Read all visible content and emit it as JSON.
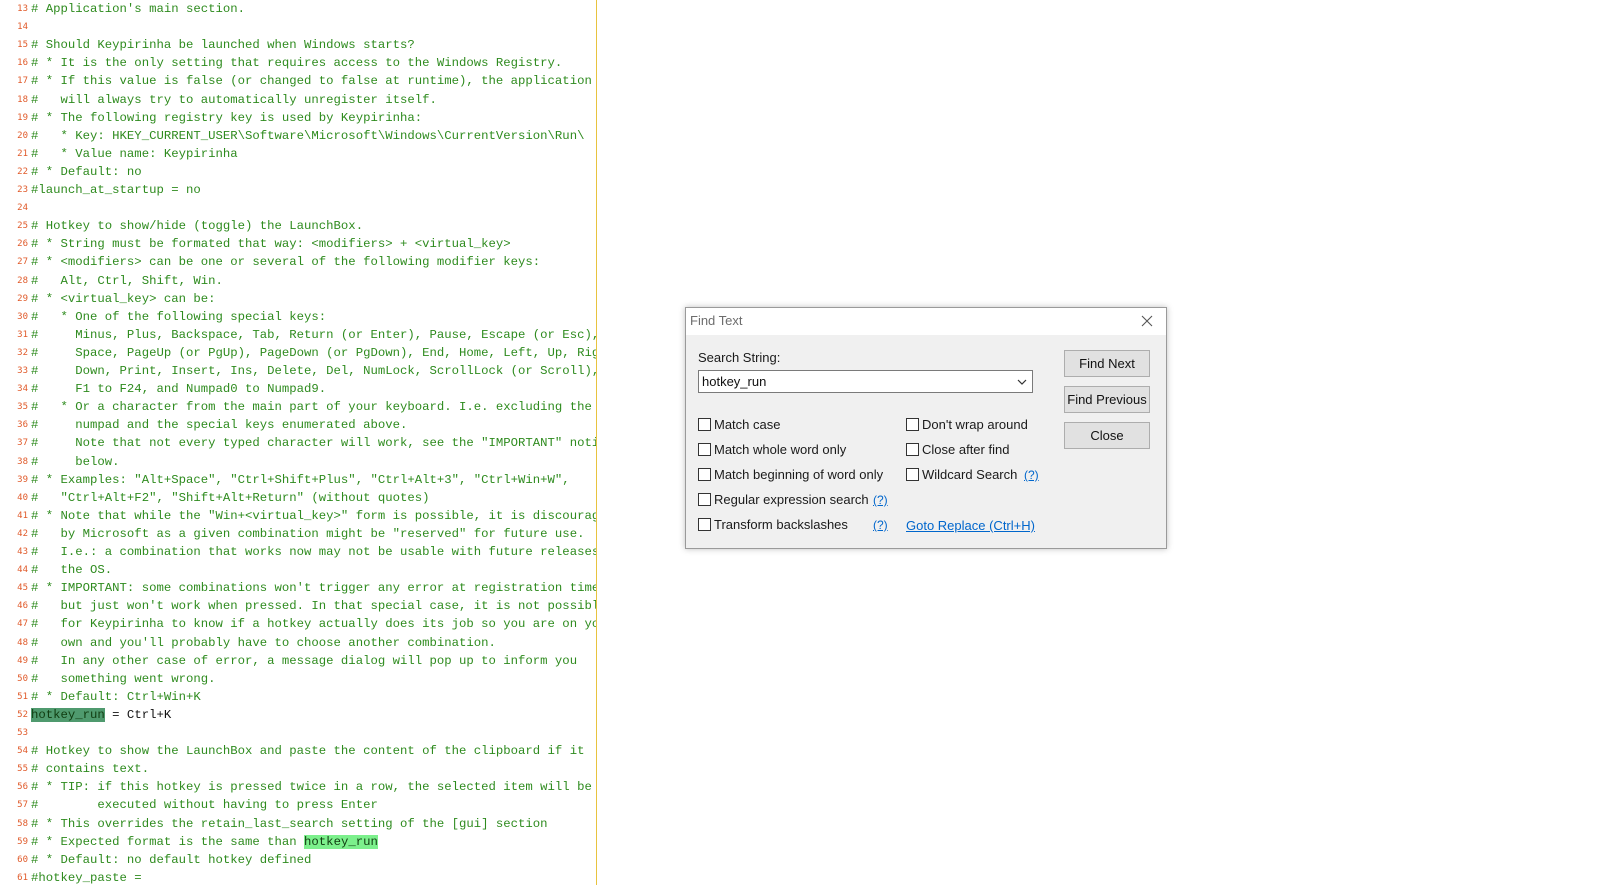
{
  "editor": {
    "lines": [
      {
        "num": "13",
        "text": "# Application's main section."
      },
      {
        "num": "14",
        "text": ""
      },
      {
        "num": "15",
        "text": "# Should Keypirinha be launched when Windows starts?"
      },
      {
        "num": "16",
        "text": "# * It is the only setting that requires access to the Windows Registry."
      },
      {
        "num": "17",
        "text": "# * If this value is false (or changed to false at runtime), the application"
      },
      {
        "num": "18",
        "text": "#   will always try to automatically unregister itself."
      },
      {
        "num": "19",
        "text": "# * The following registry key is used by Keypirinha:"
      },
      {
        "num": "20",
        "text": "#   * Key: HKEY_CURRENT_USER\\Software\\Microsoft\\Windows\\CurrentVersion\\Run\\"
      },
      {
        "num": "21",
        "text": "#   * Value name: Keypirinha"
      },
      {
        "num": "22",
        "text": "# * Default: no"
      },
      {
        "num": "23",
        "text": "#launch_at_startup = no"
      },
      {
        "num": "24",
        "text": ""
      },
      {
        "num": "25",
        "text": "# Hotkey to show/hide (toggle) the LaunchBox."
      },
      {
        "num": "26",
        "text": "# * String must be formated that way: <modifiers> + <virtual_key>"
      },
      {
        "num": "27",
        "text": "# * <modifiers> can be one or several of the following modifier keys:"
      },
      {
        "num": "28",
        "text": "#   Alt, Ctrl, Shift, Win."
      },
      {
        "num": "29",
        "text": "# * <virtual_key> can be:"
      },
      {
        "num": "30",
        "text": "#   * One of the following special keys:"
      },
      {
        "num": "31",
        "text": "#     Minus, Plus, Backspace, Tab, Return (or Enter), Pause, Escape (or Esc),"
      },
      {
        "num": "32",
        "text": "#     Space, PageUp (or PgUp), PageDown (or PgDown), End, Home, Left, Up, Right,"
      },
      {
        "num": "33",
        "text": "#     Down, Print, Insert, Ins, Delete, Del, NumLock, ScrollLock (or Scroll),"
      },
      {
        "num": "34",
        "text": "#     F1 to F24, and Numpad0 to Numpad9."
      },
      {
        "num": "35",
        "text": "#   * Or a character from the main part of your keyboard. I.e. excluding the"
      },
      {
        "num": "36",
        "text": "#     numpad and the special keys enumerated above."
      },
      {
        "num": "37",
        "text": "#     Note that not every typed character will work, see the \"IMPORTANT\" notice"
      },
      {
        "num": "38",
        "text": "#     below."
      },
      {
        "num": "39",
        "text": "# * Examples: \"Alt+Space\", \"Ctrl+Shift+Plus\", \"Ctrl+Alt+3\", \"Ctrl+Win+W\","
      },
      {
        "num": "40",
        "text": "#   \"Ctrl+Alt+F2\", \"Shift+Alt+Return\" (without quotes)"
      },
      {
        "num": "41",
        "text": "# * Note that while the \"Win+<virtual_key>\" form is possible, it is discouraged"
      },
      {
        "num": "42",
        "text": "#   by Microsoft as a given combination might be \"reserved\" for future use."
      },
      {
        "num": "43",
        "text": "#   I.e.: a combination that works now may not be usable with future releases of"
      },
      {
        "num": "44",
        "text": "#   the OS."
      },
      {
        "num": "45",
        "text": "# * IMPORTANT: some combinations won't trigger any error at registration time"
      },
      {
        "num": "46",
        "text": "#   but just won't work when pressed. In that special case, it is not possible"
      },
      {
        "num": "47",
        "text": "#   for Keypirinha to know if a hotkey actually does its job so you are on your"
      },
      {
        "num": "48",
        "text": "#   own and you'll probably have to choose another combination."
      },
      {
        "num": "49",
        "text": "#   In any other case of error, a message dialog will pop up to inform you"
      },
      {
        "num": "50",
        "text": "#   something went wrong."
      },
      {
        "num": "51",
        "text": "# * Default: Ctrl+Win+K"
      },
      {
        "num": "52",
        "text": "",
        "hl": "hotkey_run",
        "rest": " = Ctrl+K",
        "hl_kind": "sel",
        "setting": true
      },
      {
        "num": "53",
        "text": ""
      },
      {
        "num": "54",
        "text": "# Hotkey to show the LaunchBox and paste the content of the clipboard if it"
      },
      {
        "num": "55",
        "text": "# contains text."
      },
      {
        "num": "56",
        "text": "# * TIP: if this hotkey is pressed twice in a row, the selected item will be"
      },
      {
        "num": "57",
        "text": "#        executed without having to press Enter"
      },
      {
        "num": "58",
        "text": "# * This overrides the retain_last_search setting of the [gui] section"
      },
      {
        "num": "59",
        "text": "# * Expected format is the same than ",
        "hl": "hotkey_run",
        "rest": "",
        "hl_kind": "match"
      },
      {
        "num": "60",
        "text": "# * Default: no default hotkey defined"
      },
      {
        "num": "61",
        "text": "#hotkey_paste ="
      }
    ]
  },
  "dialog": {
    "title": "Find Text",
    "search_label": "Search String:",
    "search_value": "hotkey_run",
    "buttons": {
      "find_next": "Find Next",
      "find_previous": "Find Previous",
      "close": "Close"
    },
    "options_left": [
      {
        "label": "Match case",
        "checked": false
      },
      {
        "label": "Match whole word only",
        "checked": false
      },
      {
        "label": "Match beginning of word only",
        "checked": false
      },
      {
        "label": "Regular expression search",
        "checked": false
      },
      {
        "label": "Transform backslashes",
        "checked": false
      }
    ],
    "options_right": [
      {
        "label": "Don't wrap around",
        "checked": false
      },
      {
        "label": "Close after find",
        "checked": false
      },
      {
        "label": "Wildcard Search",
        "checked": false
      }
    ],
    "help_link": "(?)",
    "goto_replace": "Goto Replace (Ctrl+H)"
  }
}
